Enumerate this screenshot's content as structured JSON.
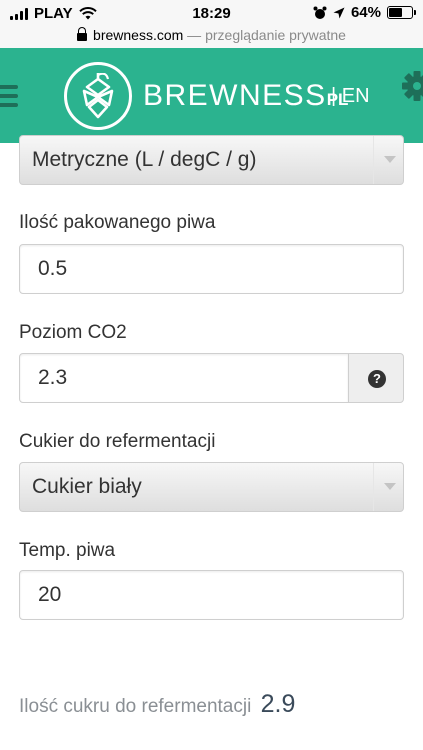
{
  "status_bar": {
    "carrier": "PLAY",
    "time": "18:29",
    "battery": "64%",
    "battery_level": 0.64
  },
  "browser": {
    "domain": "brewness.com",
    "separator": " — ",
    "mode": "przeglądanie prywatne"
  },
  "header": {
    "brand": "BREWNESS",
    "brand_suffix": "PL",
    "language_separator": "|",
    "language_link": "EN",
    "accent_color": "#2bb38f"
  },
  "form": {
    "units_select": {
      "value": "Metryczne (L / degC / g)"
    },
    "beer_amount": {
      "label": "Ilość pakowanego piwa",
      "value": "0.5"
    },
    "co2_level": {
      "label": "Poziom CO2",
      "value": "2.3",
      "help_icon": "?"
    },
    "priming_sugar": {
      "label": "Cukier do refermentacji",
      "value": "Cukier biały"
    },
    "beer_temp": {
      "label": "Temp. piwa",
      "value": "20"
    }
  },
  "result": {
    "label": "Ilość cukru do refermentacji",
    "value": "2.9"
  }
}
